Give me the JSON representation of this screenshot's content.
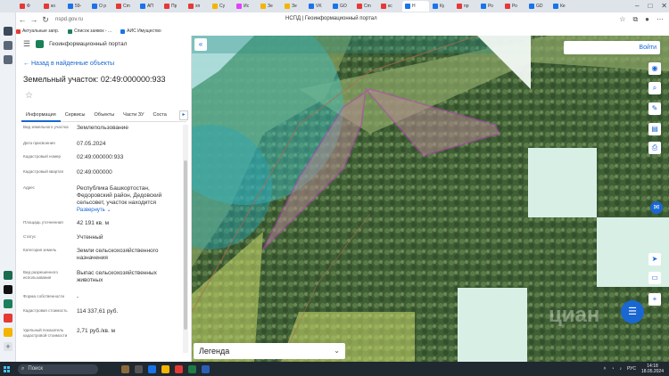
{
  "browser": {
    "tabs": [
      {
        "label": "Ф",
        "color": "#e53935"
      },
      {
        "label": "ко",
        "color": "#e53935"
      },
      {
        "label": "59-",
        "color": "#1a73e8"
      },
      {
        "label": "О р",
        "color": "#1a73e8"
      },
      {
        "label": "Cm",
        "color": "#e53935"
      },
      {
        "label": "АП",
        "color": "#1a73e8"
      },
      {
        "label": "Пр",
        "color": "#e53935"
      },
      {
        "label": "хп",
        "color": "#e53935"
      },
      {
        "label": "Су",
        "color": "#f4b400"
      },
      {
        "label": "Иc",
        "color": "#e040fb"
      },
      {
        "label": "Зе",
        "color": "#f4b400"
      },
      {
        "label": "Зе",
        "color": "#f4b400"
      },
      {
        "label": "VK",
        "color": "#1a73e8"
      },
      {
        "label": "GO",
        "color": "#1a73e8"
      },
      {
        "label": "Cm",
        "color": "#e53935"
      },
      {
        "label": "кс",
        "color": "#e53935"
      },
      {
        "label": "Н",
        "color": "#1a73e8",
        "active": true
      },
      {
        "label": "Ку",
        "color": "#1a73e8"
      },
      {
        "label": "пр",
        "color": "#e53935"
      },
      {
        "label": "Ро",
        "color": "#1a73e8"
      },
      {
        "label": "Ро",
        "color": "#e53935"
      },
      {
        "label": "GD",
        "color": "#1a73e8"
      },
      {
        "label": "Ке",
        "color": "#1a73e8"
      }
    ],
    "url": "nspd.gov.ru",
    "page_title": "НСПД | Геоинформационный портал",
    "bookmarks": [
      {
        "label": "Актуальные запр.",
        "color": "#e53935"
      },
      {
        "label": "Список заявок - ...",
        "color": "#1b7f5a"
      },
      {
        "label": "АИС Имущество",
        "color": "#1a73e8"
      }
    ]
  },
  "panel": {
    "portal_name": "Геоинформационный портал",
    "back_link": "Назад в найденные объекты",
    "title": "Земельный участок: 02:49:000000:933",
    "tabs": [
      "Информация",
      "Сервисы",
      "Объекты",
      "Части ЗУ",
      "Соста"
    ],
    "properties": [
      {
        "label": "Вид земельного участка",
        "value": "Землепользование"
      },
      {
        "label": "Дата присвоения",
        "value": "07.05.2024"
      },
      {
        "label": "Кадастровый номер",
        "value": "02:49:000000:933"
      },
      {
        "label": "Кадастровый квартал",
        "value": "02:49:000000"
      },
      {
        "label": "Адрес",
        "value": "Республика Башкортостан, Федоровский район, Дедовский сельсовет, участок находится",
        "link": "Развернуть"
      },
      {
        "label": "Площадь уточненная",
        "value": "42 191 кв. м"
      },
      {
        "label": "Статус",
        "value": "Учтенный"
      },
      {
        "label": "Категория земель",
        "value": "Земли сельскохозяйственного назначения"
      },
      {
        "label": "Вид разрешенного использования",
        "value": "Выпас сельскохозяйственных животных"
      },
      {
        "label": "Форма собственности",
        "value": "-"
      },
      {
        "label": "Кадастровая стоимость",
        "value": "114 337,61 руб."
      },
      {
        "label": "Удельный показатель кадастровой стоимости",
        "value": "2,71 руб./кв. м"
      }
    ]
  },
  "map": {
    "login_label": "Войти",
    "legend_label": "Легенда",
    "watermark": "циан"
  },
  "taskbar": {
    "search_label": "Поиск",
    "lang": "РУС",
    "time": "14:18",
    "date": "18.05.2024"
  },
  "colors": {
    "accent": "#1967d2",
    "parcel_fill": "#b58a92",
    "parcel_stroke": "#c040c0"
  }
}
